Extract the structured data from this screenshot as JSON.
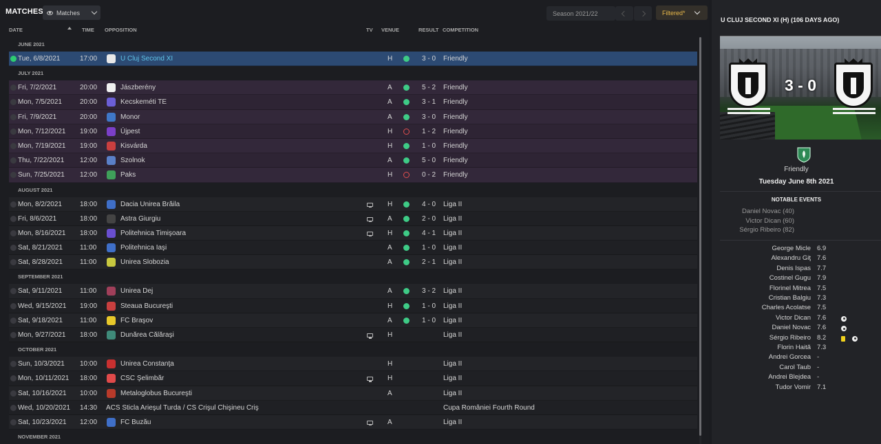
{
  "header": {
    "title": "MATCHES",
    "view_label": "Matches",
    "season_label": "Season 2021/22",
    "filter_label": "Filtered*"
  },
  "columns": {
    "date": "DATE",
    "time": "TIME",
    "opposition": "OPPOSITION",
    "tv": "TV",
    "venue": "VENUE",
    "result": "RESULT",
    "competition": "COMPETITION"
  },
  "groups": [
    {
      "month": "JUNE 2021",
      "matches": [
        {
          "date": "Tue, 6/8/2021",
          "time": "17:00",
          "opp": "U Cluj Second XI",
          "tv": false,
          "venue": "H",
          "outcome": "win",
          "result": "3 - 0",
          "comp": "Friendly",
          "selected": true,
          "badge_color": "#e8e8e8",
          "badge_text_color": "#111"
        }
      ]
    },
    {
      "month": "JULY 2021",
      "matches": [
        {
          "date": "Fri, 7/2/2021",
          "time": "20:00",
          "opp": "Jászberény",
          "tv": false,
          "venue": "A",
          "outcome": "win",
          "result": "5 - 2",
          "comp": "Friendly",
          "badge_color": "#f0f0f0",
          "badge_text_color": "#333"
        },
        {
          "date": "Mon, 7/5/2021",
          "time": "20:00",
          "opp": "Kecskeméti TE",
          "tv": false,
          "venue": "A",
          "outcome": "win",
          "result": "3 - 1",
          "comp": "Friendly",
          "badge_color": "#6b5fd6"
        },
        {
          "date": "Fri, 7/9/2021",
          "time": "20:00",
          "opp": "Monor",
          "tv": false,
          "venue": "A",
          "outcome": "win",
          "result": "3 - 0",
          "comp": "Friendly",
          "badge_color": "#3f78c8"
        },
        {
          "date": "Mon, 7/12/2021",
          "time": "19:00",
          "opp": "Újpest",
          "tv": false,
          "venue": "H",
          "outcome": "loss",
          "result": "1 - 2",
          "comp": "Friendly",
          "badge_color": "#7b3fc8"
        },
        {
          "date": "Mon, 7/19/2021",
          "time": "19:00",
          "opp": "Kisvárda",
          "tv": false,
          "venue": "H",
          "outcome": "win",
          "result": "1 - 0",
          "comp": "Friendly",
          "badge_color": "#c83f3f"
        },
        {
          "date": "Thu, 7/22/2021",
          "time": "12:00",
          "opp": "Szolnok",
          "tv": false,
          "venue": "A",
          "outcome": "win",
          "result": "5 - 0",
          "comp": "Friendly",
          "highlight": true,
          "badge_color": "#5a80c8"
        },
        {
          "date": "Sun, 7/25/2021",
          "time": "12:00",
          "opp": "Paks",
          "tv": false,
          "venue": "H",
          "outcome": "loss",
          "result": "0 - 2",
          "comp": "Friendly",
          "badge_color": "#3fa05a"
        }
      ]
    },
    {
      "month": "AUGUST 2021",
      "matches": [
        {
          "date": "Mon, 8/2/2021",
          "time": "18:00",
          "opp": "Dacia Unirea Brăila",
          "tv": true,
          "venue": "H",
          "outcome": "win",
          "result": "4 - 0",
          "comp": "Liga II",
          "badge_color": "#3f6fc8"
        },
        {
          "date": "Fri, 8/6/2021",
          "time": "18:00",
          "opp": "Astra Giurgiu",
          "tv": true,
          "venue": "A",
          "outcome": "win",
          "result": "2 - 0",
          "comp": "Liga II",
          "badge_color": "#444",
          "badge_text_color": "#fff"
        },
        {
          "date": "Mon, 8/16/2021",
          "time": "18:00",
          "opp": "Politehnica Timişoara",
          "tv": true,
          "venue": "H",
          "outcome": "win",
          "result": "4 - 1",
          "comp": "Liga II",
          "badge_color": "#6a4fd0"
        },
        {
          "date": "Sat, 8/21/2021",
          "time": "11:00",
          "opp": "Politehnica Iaşi",
          "tv": false,
          "venue": "A",
          "outcome": "win",
          "result": "1 - 0",
          "comp": "Liga II",
          "badge_color": "#3f6fc8"
        },
        {
          "date": "Sat, 8/28/2021",
          "time": "11:00",
          "opp": "Unirea Slobozia",
          "tv": false,
          "venue": "A",
          "outcome": "win",
          "result": "2 - 1",
          "comp": "Liga II",
          "badge_color": "#c8c83f",
          "badge_text_color": "#222"
        }
      ]
    },
    {
      "month": "SEPTEMBER 2021",
      "matches": [
        {
          "date": "Sat, 9/11/2021",
          "time": "11:00",
          "opp": "Unirea Dej",
          "tv": false,
          "venue": "A",
          "outcome": "win",
          "result": "3 - 2",
          "comp": "Liga II",
          "badge_color": "#a03f5a"
        },
        {
          "date": "Wed, 9/15/2021",
          "time": "19:00",
          "opp": "Steaua Bucureşti",
          "tv": false,
          "venue": "H",
          "outcome": "win",
          "result": "1 - 0",
          "comp": "Liga II",
          "badge_color": "#c83f3f"
        },
        {
          "date": "Sat, 9/18/2021",
          "time": "11:00",
          "opp": "FC Braşov",
          "tv": false,
          "venue": "A",
          "outcome": "win",
          "result": "1 - 0",
          "comp": "Liga II",
          "badge_color": "#e8c82a",
          "badge_text_color": "#222"
        },
        {
          "date": "Mon, 9/27/2021",
          "time": "18:00",
          "opp": "Dunărea Călăraşi",
          "tv": true,
          "venue": "H",
          "outcome": "none",
          "result": "",
          "comp": "Liga II",
          "badge_color": "#3f8a7a"
        }
      ]
    },
    {
      "month": "OCTOBER 2021",
      "matches": [
        {
          "date": "Sun, 10/3/2021",
          "time": "10:00",
          "opp": "Unirea Constanţa",
          "tv": false,
          "venue": "H",
          "outcome": "none",
          "result": "",
          "comp": "Liga II",
          "badge_color": "#c83030"
        },
        {
          "date": "Mon, 10/11/2021",
          "time": "18:00",
          "opp": "CSC Şelimbăr",
          "tv": true,
          "venue": "H",
          "outcome": "none",
          "result": "",
          "comp": "Liga II",
          "badge_color": "#e04a4a"
        },
        {
          "date": "Sat, 10/16/2021",
          "time": "10:00",
          "opp": "Metaloglobus Bucureşti",
          "tv": false,
          "venue": "A",
          "outcome": "none",
          "result": "",
          "comp": "Liga II",
          "badge_color": "#b83a2a"
        },
        {
          "date": "Wed, 10/20/2021",
          "time": "14:30",
          "opp": "ACS Sticla Arieşul Turda / CS Crişul Chişineu Criş",
          "tv": false,
          "venue": "",
          "outcome": "none",
          "result": "",
          "comp": "Cupa României Fourth Round",
          "no_badge": true
        },
        {
          "date": "Sat, 10/23/2021",
          "time": "12:00",
          "opp": "FC Buzău",
          "tv": true,
          "venue": "A",
          "outcome": "none",
          "result": "",
          "comp": "Liga II",
          "badge_color": "#3f6fc8"
        }
      ]
    },
    {
      "month": "NOVEMBER 2021",
      "matches": []
    }
  ],
  "detail": {
    "title": "U CLUJ SECOND XI (H) (106 DAYS AGO)",
    "score": "3 - 0",
    "competition": "Friendly",
    "date": "Tuesday June 8th 2021",
    "notable_heading": "NOTABLE EVENTS",
    "events": [
      "Daniel Novac (40)",
      "Victor Dican (60)",
      "Sérgio Ribeiro (82)"
    ],
    "players": [
      {
        "name": "George Micle",
        "rating": "6.9",
        "icons": []
      },
      {
        "name": "Alexandru Giţ",
        "rating": "7.6",
        "icons": []
      },
      {
        "name": "Denis Ispas",
        "rating": "7.7",
        "icons": []
      },
      {
        "name": "Costinel Gugu",
        "rating": "7.9",
        "icons": []
      },
      {
        "name": "Florinel Mitrea",
        "rating": "7.5",
        "icons": []
      },
      {
        "name": "Cristian Balgiu",
        "rating": "7.3",
        "icons": []
      },
      {
        "name": "Charles Acolatse",
        "rating": "7.5",
        "icons": []
      },
      {
        "name": "Victor Dican",
        "rating": "7.6",
        "icons": [
          "goal"
        ]
      },
      {
        "name": "Daniel Novac",
        "rating": "7.6",
        "icons": [
          "goal"
        ]
      },
      {
        "name": "Sérgio Ribeiro",
        "rating": "8.2",
        "icons": [
          "yellow",
          "goal"
        ]
      },
      {
        "name": "Florin Haită",
        "rating": "7.3",
        "icons": []
      },
      {
        "name": "Andrei Gorcea",
        "rating": "-",
        "icons": []
      },
      {
        "name": "Carol Taub",
        "rating": "-",
        "icons": []
      },
      {
        "name": "Andrei Blejdea",
        "rating": "-",
        "icons": []
      },
      {
        "name": "Tudor Vomir",
        "rating": "7.1",
        "icons": []
      }
    ]
  },
  "colors": {
    "accent_selected": "#2c4a73",
    "friendly_row": "#33283a",
    "win": "#3ecb86",
    "loss": "#e04e4e",
    "filter_text": "#e8b84a"
  }
}
